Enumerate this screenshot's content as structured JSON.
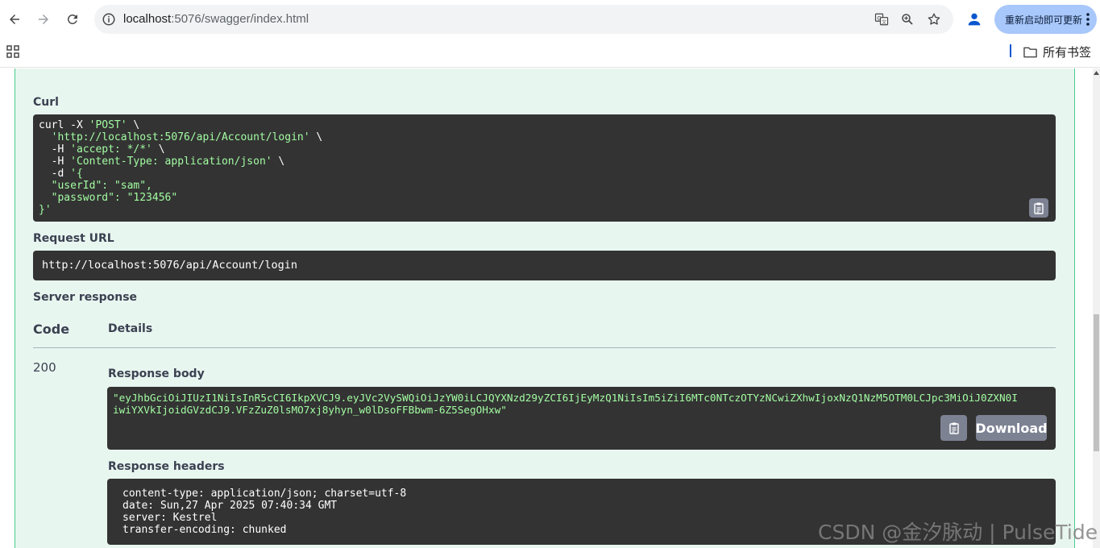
{
  "browser": {
    "url_host": "localhost",
    "url_rest": ":5076/swagger/index.html",
    "update_button": "重新启动即可更新",
    "bookmarks_folder": "所有书签",
    "icons": [
      "back-icon",
      "forward-icon",
      "reload-icon",
      "site-info-icon",
      "translate-icon",
      "zoom-icon",
      "star-icon",
      "profile-icon",
      "menu-dots-icon",
      "apps-grid-icon",
      "folder-icon"
    ],
    "accent_color": "#0b57d0"
  },
  "swagger": {
    "curl_label": "Curl",
    "curl_lines": [
      {
        "plain": "curl -X ",
        "str": "'POST'",
        "tail": " \\"
      },
      {
        "plain": "  ",
        "str": "'http://localhost:5076/api/Account/login'",
        "tail": " \\"
      },
      {
        "plain": "  -H ",
        "str": "'accept: */*'",
        "tail": " \\"
      },
      {
        "plain": "  -H ",
        "str": "'Content-Type: application/json'",
        "tail": " \\"
      },
      {
        "plain": "  -d ",
        "str": "'{",
        "tail": ""
      },
      {
        "plain": "  ",
        "str": "\"userId\": \"sam\",",
        "tail": ""
      },
      {
        "plain": "  ",
        "str": "\"password\": \"123456\"",
        "tail": ""
      },
      {
        "plain": "",
        "str": "}'",
        "tail": ""
      }
    ],
    "request_url_label": "Request URL",
    "request_url": "http://localhost:5076/api/Account/login",
    "server_response_label": "Server response",
    "col_code": "Code",
    "col_details": "Details",
    "status_code": "200",
    "response_body_label": "Response body",
    "response_body_line1": "\"eyJhbGciOiJIUzI1NiIsInR5cCI6IkpXVCJ9.eyJVc2VySWQiOiJzYW0iLCJQYXNzd29yZCI6IjEyMzQ1NiIsIm5iZiI6MTc0NTczOTYzNCwiZXhwIjoxNzQ1NzM5OTM0LCJpc3MiOiJ0ZXN0I",
    "response_body_line2": "iwiYXVkIjoidGVzdCJ9.VFzZuZ0lsMO7xj8yhyn_w0lDsoFFBbwm-6Z5SegOHxw\"",
    "download_label": "Download",
    "response_headers_label": "Response headers",
    "response_headers": [
      "content-type: application/json; charset=utf-8",
      "date: Sun,27 Apr 2025 07:40:34 GMT",
      "server: Kestrel",
      "transfer-encoding: chunked"
    ],
    "colors": {
      "block_bg": "#e8f6f0",
      "block_border": "#49cc90",
      "code_bg": "#333333",
      "string_green": "#a2fca2"
    }
  },
  "watermark": "CSDN @金汐脉动 | PulseTide"
}
